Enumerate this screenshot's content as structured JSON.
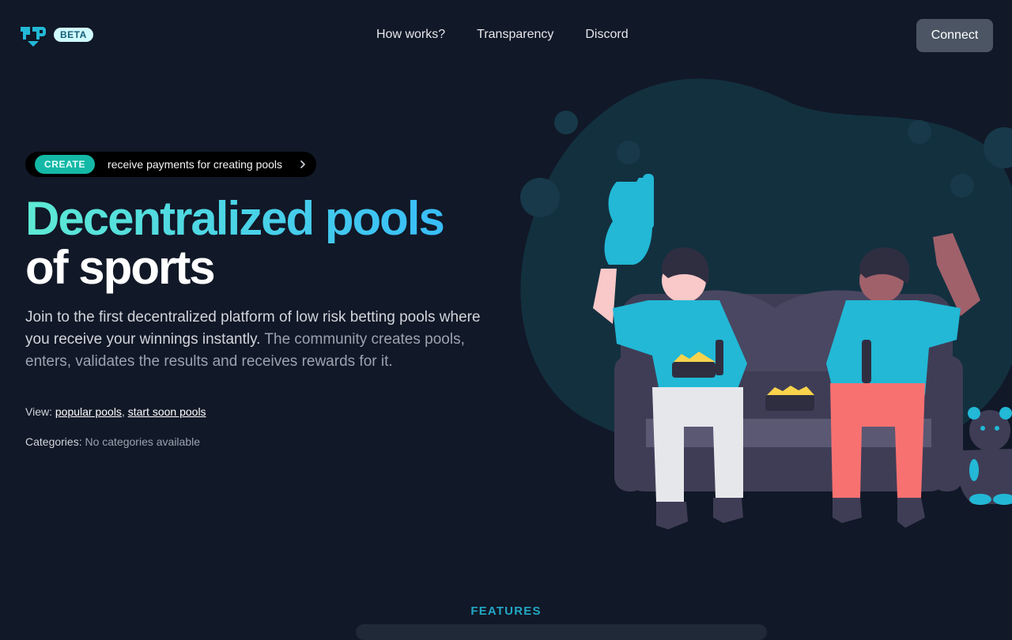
{
  "header": {
    "logo_icon": "pp-logo-icon",
    "beta_label": "BETA",
    "nav": [
      "How works?",
      "Transparency",
      "Discord"
    ],
    "connect_label": "Connect"
  },
  "hero": {
    "pill_badge": "CREATE",
    "pill_text": "receive payments for creating pools",
    "pill_icon": "chevron-right-icon",
    "title_line1": "Decentralized pools",
    "title_line2": "of sports",
    "description_main": "Join to the first decentralized platform of low risk betting pools where you receive your winnings instantly.",
    "description_muted": " The community creates pools, enters, validates the results and receives rewards for it.",
    "view_label": "View: ",
    "view_links": [
      "popular pools",
      "start soon pools"
    ],
    "view_separator": ", ",
    "categories_label": "Categories: ",
    "categories_value": "No categories available"
  },
  "features_label": "FEATURES",
  "colors": {
    "background": "#111827",
    "accent_teal": "#14b8a6",
    "accent_cyan": "#22d3ee",
    "jersey": "#22b8d6",
    "connect_bg": "#4b5563"
  }
}
